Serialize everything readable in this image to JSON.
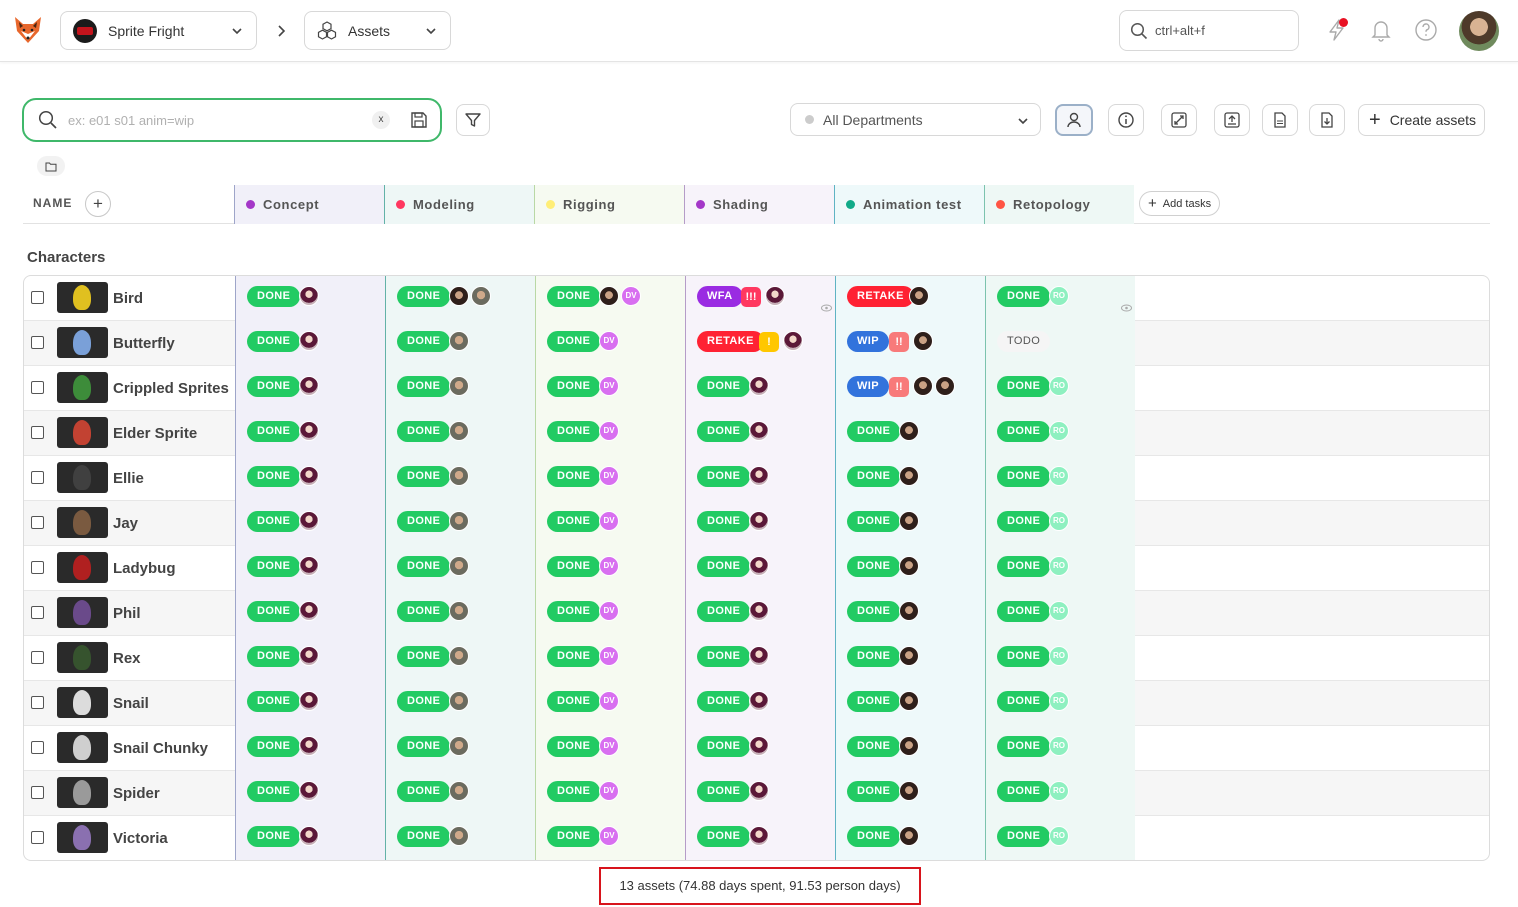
{
  "topbar": {
    "production": "Sprite Fright",
    "section": "Assets",
    "search_placeholder": "ctrl+alt+f"
  },
  "toolbar": {
    "search_placeholder": "ex: e01 s01 anim=wip",
    "clear_label": "x",
    "department": "All Departments",
    "create_label": "Create assets"
  },
  "table": {
    "name_header": "NAME",
    "add_tasks_label": "Add tasks",
    "columns": [
      {
        "name": "Concept",
        "color": "#a437c8",
        "bg": "#f1f0f9",
        "border": "#9ea5c9"
      },
      {
        "name": "Modeling",
        "color": "#ff3860",
        "bg": "#eef7f6",
        "border": "#63b2a8"
      },
      {
        "name": "Rigging",
        "color": "#ffee77",
        "bg": "#f6faf1",
        "border": "#b9d8a5"
      },
      {
        "name": "Shading",
        "color": "#a437c8",
        "bg": "#f7f3fa",
        "border": "#b59cc8"
      },
      {
        "name": "Animation test",
        "color": "#11aa88",
        "bg": "#eef9fa",
        "border": "#5fb3c3"
      },
      {
        "name": "Retopology",
        "color": "#ff5544",
        "bg": "#eef8f5",
        "border": "#7cc3ae"
      }
    ],
    "section": "Characters",
    "rows": [
      {
        "name": "Bird",
        "thumb": "#e0c020",
        "tasks": [
          [
            "DONE",
            "",
            "v"
          ],
          [
            "DONE",
            "",
            "w,m"
          ],
          [
            "DONE",
            "",
            "w,dv"
          ],
          [
            "WFA",
            "red:!!!",
            "v"
          ],
          [
            "RETAKE",
            "",
            "w"
          ],
          [
            "DONE",
            "",
            "ro"
          ]
        ]
      },
      {
        "name": "Butterfly",
        "thumb": "#7aa0d8",
        "tasks": [
          [
            "DONE",
            "",
            "v"
          ],
          [
            "DONE",
            "",
            "m"
          ],
          [
            "DONE",
            "",
            "dv"
          ],
          [
            "RETAKE",
            "yellow:!",
            "v"
          ],
          [
            "WIP",
            "salmon:!!",
            "w"
          ],
          [
            "TODO",
            "",
            ""
          ]
        ]
      },
      {
        "name": "Crippled Sprites",
        "thumb": "#3d8c3a",
        "tasks": [
          [
            "DONE",
            "",
            "v"
          ],
          [
            "DONE",
            "",
            "m"
          ],
          [
            "DONE",
            "",
            "dv"
          ],
          [
            "DONE",
            "",
            "v"
          ],
          [
            "WIP",
            "salmon:!!",
            "w,w"
          ],
          [
            "DONE",
            "",
            "ro"
          ]
        ]
      },
      {
        "name": "Elder Sprite",
        "thumb": "#c24232",
        "tasks": [
          [
            "DONE",
            "",
            "v"
          ],
          [
            "DONE",
            "",
            "m"
          ],
          [
            "DONE",
            "",
            "dv"
          ],
          [
            "DONE",
            "",
            "v"
          ],
          [
            "DONE",
            "",
            "w"
          ],
          [
            "DONE",
            "",
            "ro"
          ]
        ]
      },
      {
        "name": "Ellie",
        "thumb": "#404040",
        "tasks": [
          [
            "DONE",
            "",
            "v"
          ],
          [
            "DONE",
            "",
            "m"
          ],
          [
            "DONE",
            "",
            "dv"
          ],
          [
            "DONE",
            "",
            "v"
          ],
          [
            "DONE",
            "",
            "w"
          ],
          [
            "DONE",
            "",
            "ro"
          ]
        ]
      },
      {
        "name": "Jay",
        "thumb": "#7a5a40",
        "tasks": [
          [
            "DONE",
            "",
            "v"
          ],
          [
            "DONE",
            "",
            "m"
          ],
          [
            "DONE",
            "",
            "dv"
          ],
          [
            "DONE",
            "",
            "v"
          ],
          [
            "DONE",
            "",
            "w"
          ],
          [
            "DONE",
            "",
            "ro"
          ]
        ]
      },
      {
        "name": "Ladybug",
        "thumb": "#b02020",
        "tasks": [
          [
            "DONE",
            "",
            "v"
          ],
          [
            "DONE",
            "",
            "m"
          ],
          [
            "DONE",
            "",
            "dv"
          ],
          [
            "DONE",
            "",
            "v"
          ],
          [
            "DONE",
            "",
            "w"
          ],
          [
            "DONE",
            "",
            "ro"
          ]
        ]
      },
      {
        "name": "Phil",
        "thumb": "#6a4a8a",
        "tasks": [
          [
            "DONE",
            "",
            "v"
          ],
          [
            "DONE",
            "",
            "m"
          ],
          [
            "DONE",
            "",
            "dv"
          ],
          [
            "DONE",
            "",
            "v"
          ],
          [
            "DONE",
            "",
            "w"
          ],
          [
            "DONE",
            "",
            "ro"
          ]
        ]
      },
      {
        "name": "Rex",
        "thumb": "#36532e",
        "tasks": [
          [
            "DONE",
            "",
            "v"
          ],
          [
            "DONE",
            "",
            "m"
          ],
          [
            "DONE",
            "",
            "dv"
          ],
          [
            "DONE",
            "",
            "v"
          ],
          [
            "DONE",
            "",
            "w"
          ],
          [
            "DONE",
            "",
            "ro"
          ]
        ]
      },
      {
        "name": "Snail",
        "thumb": "#dcdcdc",
        "tasks": [
          [
            "DONE",
            "",
            "v"
          ],
          [
            "DONE",
            "",
            "m"
          ],
          [
            "DONE",
            "",
            "dv"
          ],
          [
            "DONE",
            "",
            "v"
          ],
          [
            "DONE",
            "",
            "w"
          ],
          [
            "DONE",
            "",
            "ro"
          ]
        ]
      },
      {
        "name": "Snail Chunky",
        "thumb": "#cfcfcf",
        "tasks": [
          [
            "DONE",
            "",
            "v"
          ],
          [
            "DONE",
            "",
            "m"
          ],
          [
            "DONE",
            "",
            "dv"
          ],
          [
            "DONE",
            "",
            "v"
          ],
          [
            "DONE",
            "",
            "w"
          ],
          [
            "DONE",
            "",
            "ro"
          ]
        ]
      },
      {
        "name": "Spider",
        "thumb": "#9a9a9a",
        "tasks": [
          [
            "DONE",
            "",
            "v"
          ],
          [
            "DONE",
            "",
            "m"
          ],
          [
            "DONE",
            "",
            "dv"
          ],
          [
            "DONE",
            "",
            "v"
          ],
          [
            "DONE",
            "",
            "w"
          ],
          [
            "DONE",
            "",
            "ro"
          ]
        ]
      },
      {
        "name": "Victoria",
        "thumb": "#8a70b0",
        "tasks": [
          [
            "DONE",
            "",
            "v"
          ],
          [
            "DONE",
            "",
            "m"
          ],
          [
            "DONE",
            "",
            "dv"
          ],
          [
            "DONE",
            "",
            "v"
          ],
          [
            "DONE",
            "",
            "w"
          ],
          [
            "DONE",
            "",
            "ro"
          ]
        ]
      }
    ]
  },
  "avatar_initials": {
    "dv": "DV",
    "ro": "RO"
  },
  "footer": {
    "stats": "13 assets (74.88 days spent, 91.53 person days)"
  }
}
